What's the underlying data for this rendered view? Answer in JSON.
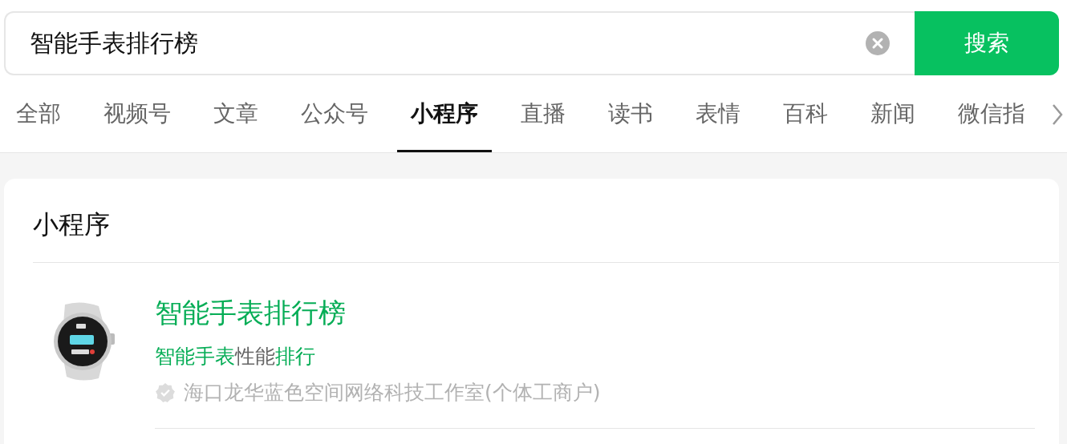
{
  "search": {
    "value": "智能手表排行榜",
    "button": "搜索"
  },
  "tabs": [
    {
      "label": "全部",
      "selected": false
    },
    {
      "label": "视频号",
      "selected": false
    },
    {
      "label": "文章",
      "selected": false
    },
    {
      "label": "公众号",
      "selected": false
    },
    {
      "label": "小程序",
      "selected": true
    },
    {
      "label": "直播",
      "selected": false
    },
    {
      "label": "读书",
      "selected": false
    },
    {
      "label": "表情",
      "selected": false
    },
    {
      "label": "百科",
      "selected": false
    },
    {
      "label": "新闻",
      "selected": false
    },
    {
      "label": "微信指",
      "selected": false
    }
  ],
  "section": {
    "title": "小程序",
    "results": [
      {
        "title": "智能手表排行榜",
        "description": [
          {
            "text": "智能手表",
            "highlight": true
          },
          {
            "text": "性能",
            "highlight": false
          },
          {
            "text": "排行",
            "highlight": true
          }
        ],
        "source": "海口龙华蓝色空间网络科技工作室(个体工商户)",
        "verified": true
      }
    ]
  }
}
